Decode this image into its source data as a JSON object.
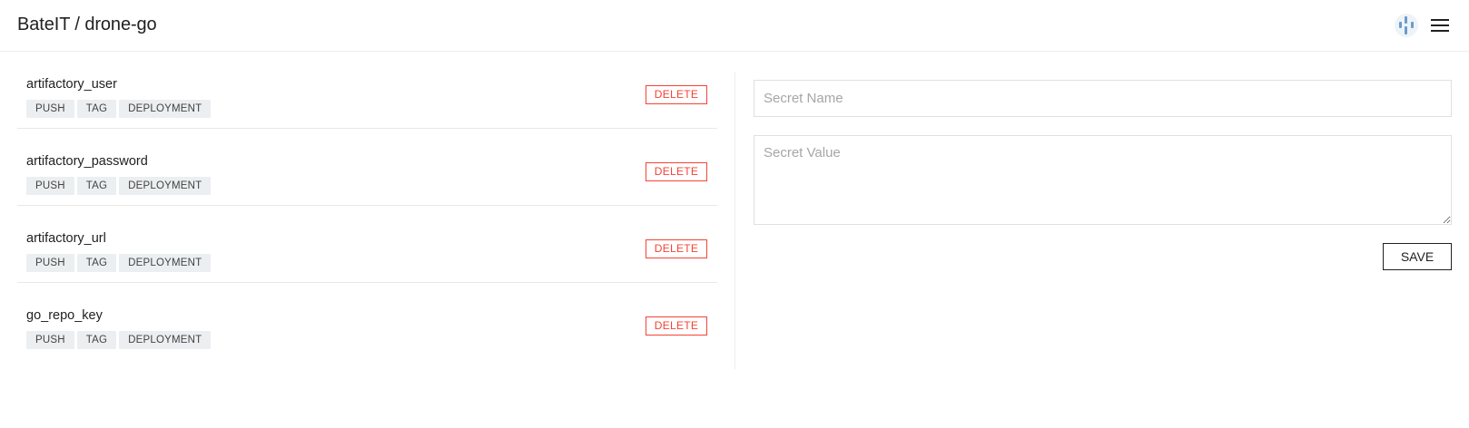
{
  "header": {
    "title": "BateIT / drone-go",
    "avatar_icon": "user-avatar-icon",
    "menu_icon": "hamburger-menu-icon"
  },
  "secrets": [
    {
      "name": "artifactory_user",
      "events": [
        "PUSH",
        "TAG",
        "DEPLOYMENT"
      ],
      "delete_label": "DELETE"
    },
    {
      "name": "artifactory_password",
      "events": [
        "PUSH",
        "TAG",
        "DEPLOYMENT"
      ],
      "delete_label": "DELETE"
    },
    {
      "name": "artifactory_url",
      "events": [
        "PUSH",
        "TAG",
        "DEPLOYMENT"
      ],
      "delete_label": "DELETE"
    },
    {
      "name": "go_repo_key",
      "events": [
        "PUSH",
        "TAG",
        "DEPLOYMENT"
      ],
      "delete_label": "DELETE"
    }
  ],
  "form": {
    "name_value": "",
    "name_placeholder": "Secret Name",
    "value_value": "",
    "value_placeholder": "Secret Value",
    "save_label": "SAVE"
  },
  "colors": {
    "delete": "#f44336",
    "tag_bg": "#eceff1",
    "avatar": "#6b9bcb"
  }
}
